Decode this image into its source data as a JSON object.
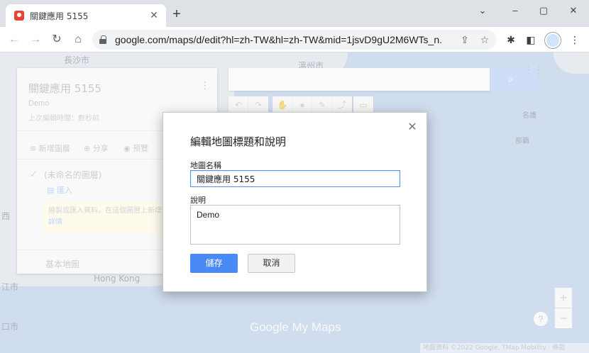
{
  "browser": {
    "tab_title": "關鍵應用 5155",
    "tab_close": "✕",
    "new_tab": "+",
    "url": "google.com/maps/d/edit?hl=zh-TW&hl=zh-TW&mid=1jsvD9gU2M6WTs_n...",
    "controls": {
      "chevron": "⌄",
      "minimize": "–",
      "maximize": "▢",
      "close": "✕"
    },
    "nav": {
      "back": "←",
      "forward": "→",
      "reload": "↻",
      "home": "⌂"
    }
  },
  "map": {
    "labels": [
      "長沙市",
      "溫州市",
      "名護",
      "那覇",
      "Hong Kong",
      "西",
      "江市",
      "口市"
    ],
    "search_placeholder": "",
    "watermark": "Google My Maps",
    "attribution": "地圖資料 ©2022 Google, TMap Mobility · 條款",
    "zoom_in": "+",
    "zoom_out": "−",
    "help": "?"
  },
  "panel": {
    "title": "關鍵應用 5155",
    "description": "Demo",
    "saved": "上次編輯時間：數秒前",
    "menu": "⋮",
    "actions": {
      "add_layer": "新增圖層",
      "share": "分享",
      "preview": "預覽"
    },
    "layer_name": "(未命名的圖層)",
    "import": "匯入",
    "hint": "繪製或匯入資料，在這個圖層上新增位置。",
    "hint_link": "瞭解詳情",
    "basemap": "基本地圖"
  },
  "dialog": {
    "title": "編輯地圖標題和說明",
    "close": "✕",
    "name_label": "地圖名稱",
    "name_value": "關鍵應用 5155",
    "desc_label": "說明",
    "desc_value": "Demo",
    "save": "儲存",
    "cancel": "取消"
  }
}
